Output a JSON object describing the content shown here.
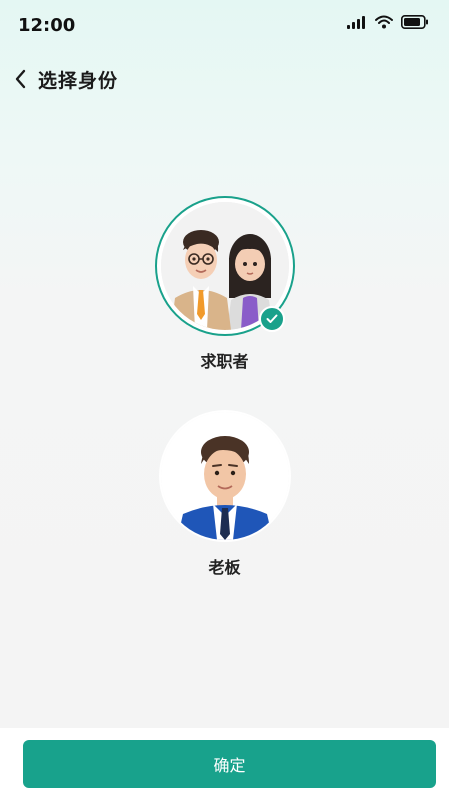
{
  "status_bar": {
    "time": "12:00",
    "icons": [
      "signal-icon",
      "wifi-icon",
      "battery-icon"
    ]
  },
  "nav": {
    "title": "选择身份",
    "back_icon": "chevron-left-icon"
  },
  "roles": [
    {
      "label": "求职者",
      "selected": true
    },
    {
      "label": "老板",
      "selected": false
    }
  ],
  "footer": {
    "confirm_label": "确定"
  },
  "colors": {
    "accent": "#18a28c",
    "background": "#f4f4f4"
  }
}
